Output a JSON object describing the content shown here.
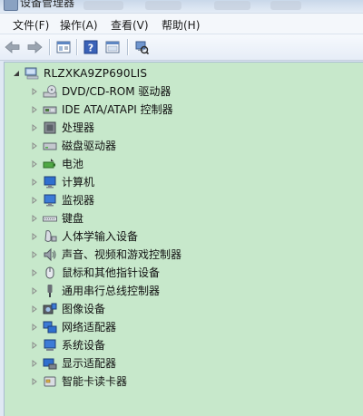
{
  "window": {
    "title": "设备管理器"
  },
  "menu": [
    "文件(F)",
    "操作(A)",
    "查看(V)",
    "帮助(H)"
  ],
  "toolbar": {
    "buttons": [
      {
        "name": "back-button",
        "icon": "arrow-left-icon"
      },
      {
        "name": "forward-button",
        "icon": "arrow-right-icon"
      },
      {
        "name": "show-hide-console-tree-button",
        "icon": "console-tree-icon"
      },
      {
        "name": "help-button",
        "icon": "help-icon"
      },
      {
        "name": "properties-view-button",
        "icon": "properties-icon"
      },
      {
        "name": "scan-hardware-button",
        "icon": "scan-hardware-icon"
      }
    ]
  },
  "tree": {
    "root": {
      "label": "RLZXKA9ZP690LIS",
      "icon": "computer-icon",
      "expanded": true
    },
    "items": [
      {
        "label": "DVD/CD-ROM 驱动器",
        "icon": "dvd-drive-icon"
      },
      {
        "label": "IDE ATA/ATAPI 控制器",
        "icon": "ide-controller-icon"
      },
      {
        "label": "处理器",
        "icon": "processor-icon"
      },
      {
        "label": "磁盘驱动器",
        "icon": "disk-drive-icon"
      },
      {
        "label": "电池",
        "icon": "battery-icon"
      },
      {
        "label": "计算机",
        "icon": "computer-monitor-icon"
      },
      {
        "label": "监视器",
        "icon": "monitor-icon"
      },
      {
        "label": "键盘",
        "icon": "keyboard-icon"
      },
      {
        "label": "人体学输入设备",
        "icon": "hid-icon"
      },
      {
        "label": "声音、视频和游戏控制器",
        "icon": "sound-icon"
      },
      {
        "label": "鼠标和其他指针设备",
        "icon": "mouse-icon"
      },
      {
        "label": "通用串行总线控制器",
        "icon": "usb-icon"
      },
      {
        "label": "图像设备",
        "icon": "imaging-device-icon"
      },
      {
        "label": "网络适配器",
        "icon": "network-adapter-icon"
      },
      {
        "label": "系统设备",
        "icon": "system-device-icon"
      },
      {
        "label": "显示适配器",
        "icon": "display-adapter-icon"
      },
      {
        "label": "智能卡读卡器",
        "icon": "smart-card-reader-icon"
      }
    ]
  },
  "colors": {
    "tree_background": "#c7e8cb",
    "menubar_background": "#f4f7fb"
  }
}
